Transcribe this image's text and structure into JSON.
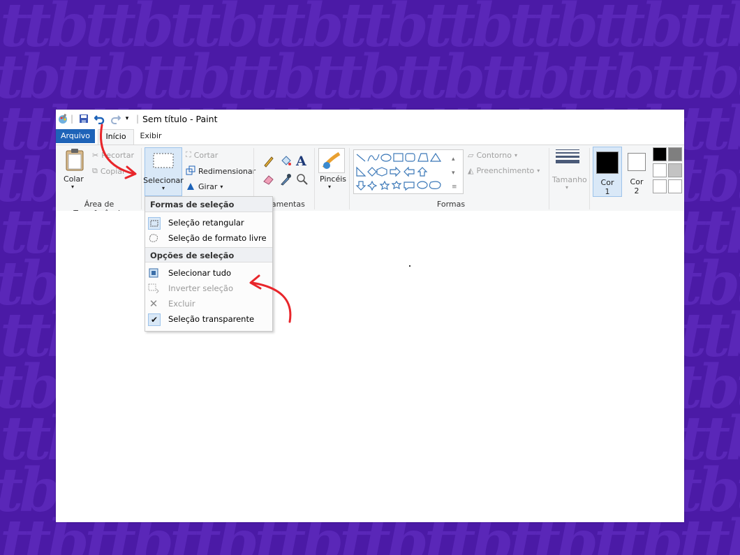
{
  "window": {
    "title": "Sem título - Paint"
  },
  "tabs": {
    "arquivo": "Arquivo",
    "inicio": "Início",
    "exibir": "Exibir"
  },
  "clipboard": {
    "paste": "Colar",
    "cut": "Recortar",
    "copy": "Copiar",
    "group_label": "Área de Transferência"
  },
  "image": {
    "select": "Selecionar",
    "crop": "Cortar",
    "resize": "Redimensionar",
    "rotate": "Girar"
  },
  "tools": {
    "group_label": "rramentas"
  },
  "brushes": {
    "label": "Pincéis"
  },
  "shapes": {
    "outline": "Contorno",
    "fill": "Preenchimento",
    "group_label": "Formas"
  },
  "size": {
    "label": "Tamanho"
  },
  "colors": {
    "color1_label": "Cor",
    "color1_num": "1",
    "color2_label": "Cor",
    "color2_num": "2",
    "color1": "#000000",
    "color2": "#ffffff",
    "palette": [
      "#000000",
      "#7f7f7f",
      "#ffffff",
      "#c3c3c3",
      "#ffffff",
      "#ffffff"
    ]
  },
  "select_menu": {
    "header_shapes": "Formas de seleção",
    "rect": "Seleção retangular",
    "free": "Seleção de formato livre",
    "header_options": "Opções de seleção",
    "select_all": "Selecionar tudo",
    "invert": "Inverter seleção",
    "delete": "Excluir",
    "transparent": "Seleção transparente"
  },
  "accent": {
    "arrow": "#e8262b",
    "file_tab": "#1e63b8",
    "background": "#4b1aa6"
  }
}
